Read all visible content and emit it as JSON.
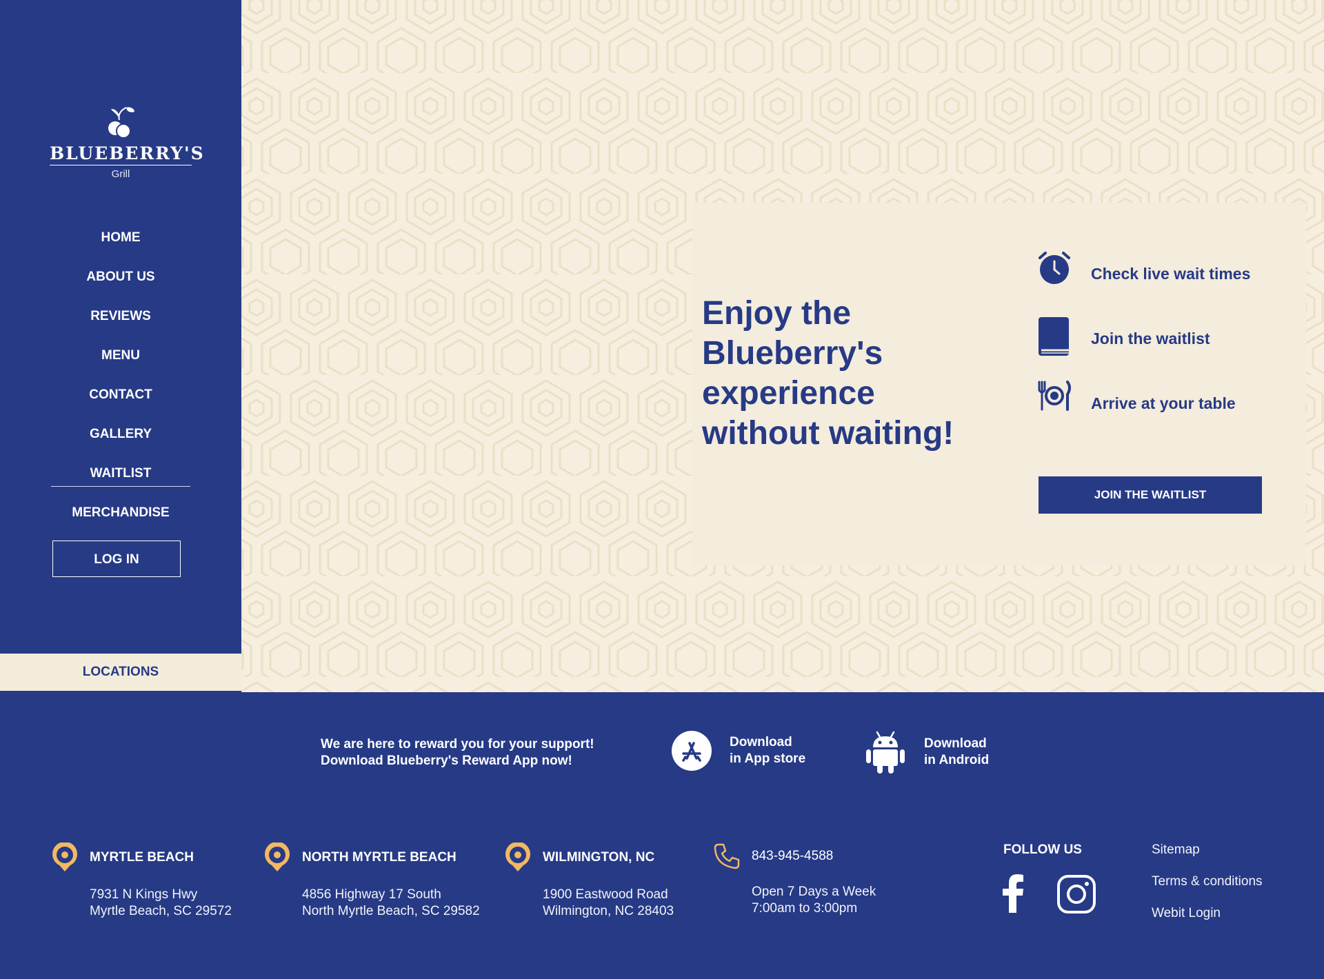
{
  "brand": {
    "name": "BLUEBERRY'S",
    "sub": "Grill"
  },
  "nav": {
    "items": [
      {
        "label": "HOME"
      },
      {
        "label": "ABOUT US"
      },
      {
        "label": "REVIEWS"
      },
      {
        "label": "MENU"
      },
      {
        "label": "CONTACT"
      },
      {
        "label": "GALLERY"
      },
      {
        "label": "WAITLIST"
      },
      {
        "label": "MERCHANDISE"
      }
    ],
    "login": "LOG IN",
    "locations": "LOCATIONS"
  },
  "hero": {
    "headline_lines": [
      "Enjoy the",
      "Blueberry's",
      "experience",
      "without waiting!"
    ],
    "features": [
      {
        "icon": "alarm-clock-icon",
        "label": "Check live wait times"
      },
      {
        "icon": "book-icon",
        "label": "Join the waitlist"
      },
      {
        "icon": "plate-cutlery-icon",
        "label": "Arrive at your table"
      }
    ],
    "cta": "JOIN THE WAITLIST"
  },
  "reward": {
    "line1": "We are here to reward you for your support!",
    "line2": "Download Blueberry's Reward App now!",
    "appstore": [
      "Download",
      "in App store"
    ],
    "android": [
      "Download",
      "in Android"
    ]
  },
  "locations": [
    {
      "title": "MYRTLE BEACH",
      "line1": "7931 N Kings Hwy",
      "line2": "Myrtle Beach, SC 29572"
    },
    {
      "title": "NORTH MYRTLE BEACH",
      "line1": "4856 Highway 17 South",
      "line2": "North Myrtle Beach, SC 29582"
    },
    {
      "title": "WILMINGTON, NC",
      "line1": "1900 Eastwood Road",
      "line2": "Wilmington, NC 28403"
    }
  ],
  "contact": {
    "phone": "843-945-4588",
    "hours1": "Open 7 Days a Week",
    "hours2": "7:00am to 3:00pm"
  },
  "follow": {
    "title": "FOLLOW US"
  },
  "footer_links": [
    "Sitemap",
    "Terms & conditions",
    "Webit Login"
  ],
  "colors": {
    "navy": "#263a86",
    "cream": "#f4ecdc",
    "pin": "#f2b862"
  }
}
